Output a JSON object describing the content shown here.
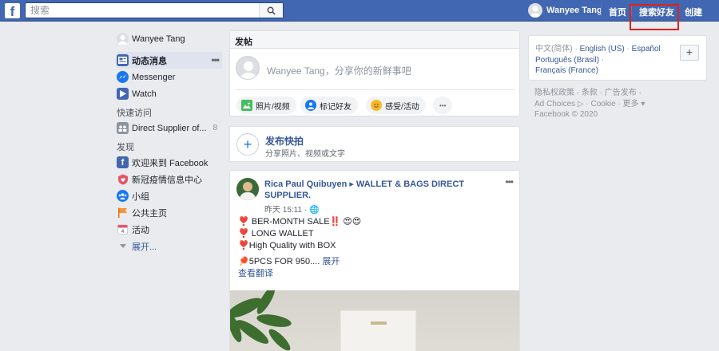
{
  "topbar": {
    "logo": "f",
    "search_placeholder": "搜索",
    "user_name": "Wanyee Tang",
    "links": [
      "首页",
      "搜索好友",
      "创建"
    ]
  },
  "leftnav": {
    "profile": "Wanyee Tang",
    "items": [
      {
        "label": "动态消息",
        "active": true
      },
      {
        "label": "Messenger"
      },
      {
        "label": "Watch"
      }
    ],
    "shortcuts_heading": "快速访问",
    "shortcuts": [
      {
        "label": "Direct Supplier of...",
        "count": "8"
      }
    ],
    "explore_heading": "发现",
    "explore": [
      {
        "label": "欢迎来到 Facebook"
      },
      {
        "label": "新冠疫情信息中心"
      },
      {
        "label": "小组"
      },
      {
        "label": "公共主页"
      },
      {
        "label": "活动"
      }
    ],
    "more": "展开..."
  },
  "composer": {
    "title": "发帖",
    "placeholder": "Wanyee Tang，分享你的新鲜事吧",
    "buttons": [
      "照片/视频",
      "标记好友",
      "感受/活动"
    ],
    "more": "•••"
  },
  "story": {
    "title": "发布快拍",
    "subtitle": "分享照片、视频或文字"
  },
  "post": {
    "author": "Rica Paul Quibuyen ▸ WALLET & BAGS DIRECT SUPPLIER.",
    "time": "昨天 15:11 · 🌐",
    "lines": [
      "❣️ BER-MONTH SALE‼️ 😍😍",
      "❣️ LONG WALLET",
      "❣️High Quality with BOX",
      "🏓5PCS FOR 950....",
      "展开",
      "查看翻译"
    ]
  },
  "right": {
    "langs": [
      "中文(简体)",
      "English (US)",
      "Español",
      "Português (Brasil)",
      "Français (France)"
    ],
    "footer": [
      "隐私权政策",
      "条款",
      "广告发布",
      "Ad Choices",
      "Cookie",
      "更多",
      "Facebook © 2020"
    ]
  },
  "colors": {
    "brand": "#4267b2",
    "link": "#365899",
    "highlight": "#e0201a"
  }
}
